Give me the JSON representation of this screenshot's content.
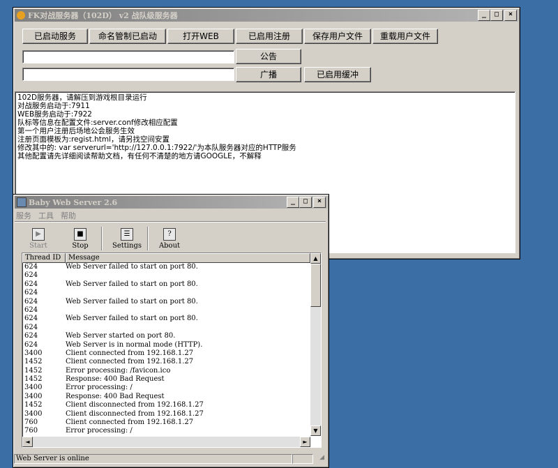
{
  "main_window": {
    "title": "FK对战服务器（102D） v2 战队级服务器",
    "buttons": [
      "已启动服务",
      "命名管制已启动",
      "打开WEB",
      "已启用注册",
      "保存用户文件",
      "重载用户文件"
    ],
    "announce_label": "公告",
    "broadcast_label": "广播",
    "buffer_label": "已启用缓冲",
    "announce_value": "",
    "broadcast_value": "",
    "log": [
      "102D服务器，请解压到游戏根目录运行",
      "对战服务启动于:7911",
      "WEB服务启动于:7922",
      "队标等信息在配置文件:server.conf修改相应配置",
      "第一个用户注册后场地公会服务生效",
      "注册页面模板为:regist.html，请另找空间安置",
      "修改其中的: var serverurl='http://127.0.0.1:7922/'为本队服务器对应的HTTP服务",
      "其他配置请先详细阅读帮助文档，有任何不清楚的地方请GOOGLE，不解释"
    ]
  },
  "web_window": {
    "title": "Baby Web Server 2.6",
    "menu": [
      "服务",
      "工具",
      "帮助"
    ],
    "toolbar": [
      {
        "label": "Start",
        "icon": "start-icon",
        "enabled": false
      },
      {
        "label": "Stop",
        "icon": "stop-icon",
        "enabled": true
      },
      {
        "label": "Settings",
        "icon": "settings-icon",
        "enabled": true
      },
      {
        "label": "About",
        "icon": "about-icon",
        "enabled": true
      }
    ],
    "columns": [
      "Thread ID",
      "Message"
    ],
    "rows": [
      [
        "624",
        "Web Server failed to start on port 80."
      ],
      [
        "624",
        ""
      ],
      [
        "624",
        "Web Server failed to start on port 80."
      ],
      [
        "624",
        ""
      ],
      [
        "624",
        "Web Server failed to start on port 80."
      ],
      [
        "624",
        ""
      ],
      [
        "624",
        "Web Server failed to start on port 80."
      ],
      [
        "624",
        ""
      ],
      [
        "624",
        "Web Server started on port 80."
      ],
      [
        "624",
        "Web Server is in normal mode (HTTP)."
      ],
      [
        "3400",
        "Client connected from 192.168.1.27"
      ],
      [
        "1452",
        "Client connected from 192.168.1.27"
      ],
      [
        "1452",
        "Error processing: /favicon.ico"
      ],
      [
        "1452",
        "Response: 400 Bad Request"
      ],
      [
        "3400",
        "Error processing: /"
      ],
      [
        "3400",
        "Response: 400 Bad Request"
      ],
      [
        "1452",
        "Client disconnected from 192.168.1.27"
      ],
      [
        "3400",
        "Client disconnected from 192.168.1.27"
      ],
      [
        "760",
        "Client connected from 192.168.1.27"
      ],
      [
        "760",
        "Error processing: /"
      ]
    ],
    "status": "Web Server is online"
  }
}
